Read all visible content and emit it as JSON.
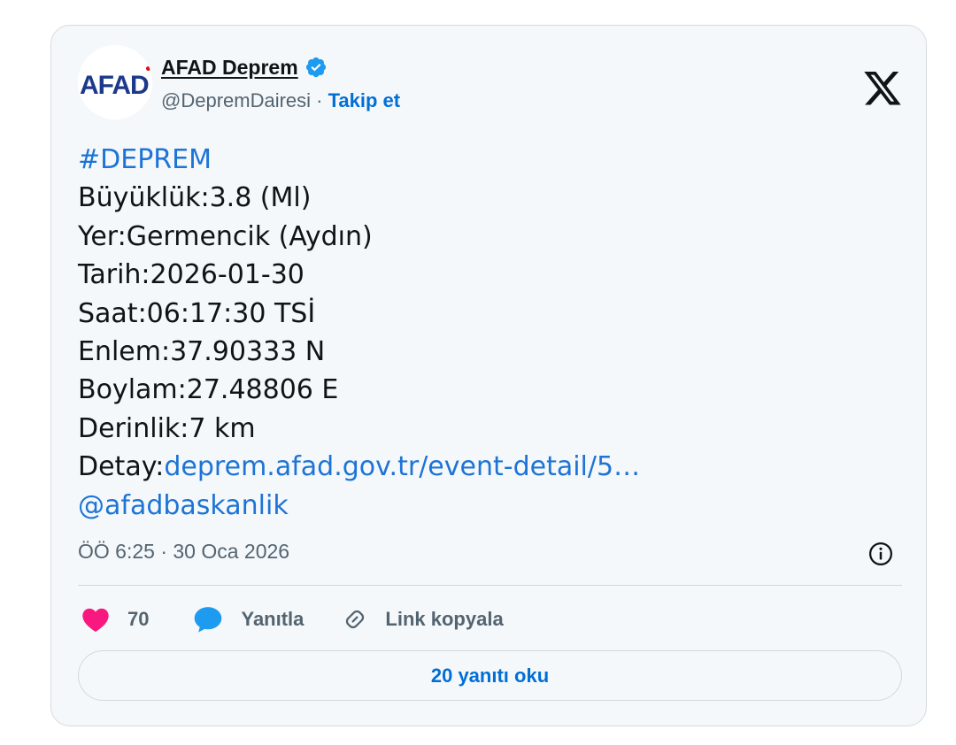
{
  "colors": {
    "link": "#1d74d6",
    "follow": "#006fd6",
    "heart": "#f91880",
    "reply_bubble": "#1d9bf0",
    "verified": "#1d9bf0",
    "text": "#0f1419",
    "muted": "#536471"
  },
  "author": {
    "avatar_text": "AFAD",
    "display_name": "AFAD Deprem",
    "verified_icon": "verified-badge-icon",
    "handle": "@DepremDairesi",
    "separator": " · ",
    "follow_label": "Takip et"
  },
  "tweet": {
    "hashtag": "#DEPREM",
    "lines": [
      "Büyüklük:3.8 (Ml)",
      "Yer:Germencik (Aydın)",
      "Tarih:2026-01-30",
      "Saat:06:17:30 TSİ",
      "Enlem:37.90333 N",
      "Boylam:27.48806 E",
      "Derinlik:7 km"
    ],
    "detail_prefix": "Detay:",
    "detail_link": "deprem.afad.gov.tr/event-detail/5…",
    "mention": "@afadbaskanlik"
  },
  "meta": {
    "timestamp": "ÖÖ 6:25 · 30 Oca 2026"
  },
  "actions": {
    "like_count": "70",
    "reply_label": "Yanıtla",
    "copy_link_label": "Link kopyala"
  },
  "read_replies_label": "20 yanıtı oku"
}
